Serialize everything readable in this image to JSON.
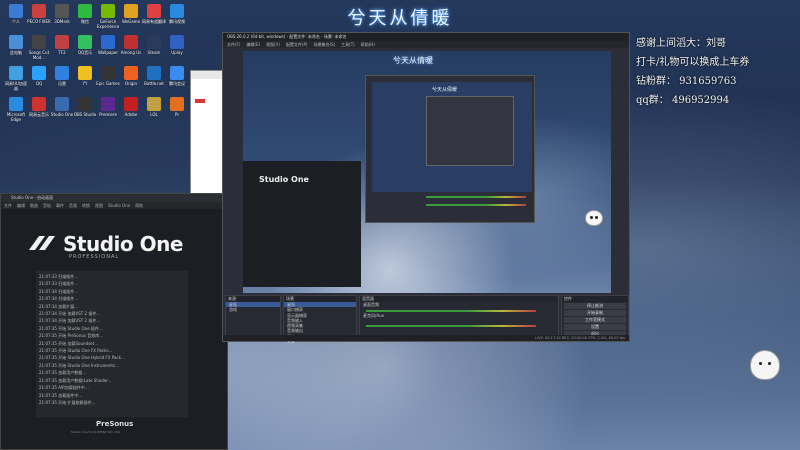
{
  "stream": {
    "title": "兮天从倩暖",
    "thanks": [
      "感谢上间滔大：刘哥",
      "打卡/礼物可以换成上车券",
      "钻粉群： 931659763",
      "qq群： 496952994"
    ]
  },
  "desktop": {
    "icons": [
      {
        "label": "个人",
        "color": "#3a7bd5"
      },
      {
        "label": "PECO FIXER",
        "color": "#c94040"
      },
      {
        "label": "3DMark",
        "color": "#555"
      },
      {
        "label": "微信",
        "color": "#2dbb3f"
      },
      {
        "label": "GeForce Experience",
        "color": "#76b900"
      },
      {
        "label": "WeGame",
        "color": "#e0a020"
      },
      {
        "label": "网易有道翻译",
        "color": "#e04040"
      },
      {
        "label": "腾讯视频",
        "color": "#2a8ae0"
      },
      {
        "label": "此电脑",
        "color": "#4a90d9"
      },
      {
        "label": "Songs Cut Mod...",
        "color": "#444"
      },
      {
        "label": "TF2",
        "color": "#c04040"
      },
      {
        "label": "QQ音乐",
        "color": "#33c060"
      },
      {
        "label": "Wallpaper",
        "color": "#2a6ad0"
      },
      {
        "label": "Among Us",
        "color": "#c03030"
      },
      {
        "label": "Steam",
        "color": "#2a3a5a"
      },
      {
        "label": "Uplay",
        "color": "#3060c0"
      },
      {
        "label": "网易UU加速器",
        "color": "#40a0e0"
      },
      {
        "label": "QQ",
        "color": "#2aa0ff"
      },
      {
        "label": "迅雷",
        "color": "#3080e0"
      },
      {
        "label": "YY",
        "color": "#f0c020"
      },
      {
        "label": "Epic Games",
        "color": "#333"
      },
      {
        "label": "Origin",
        "color": "#f06020"
      },
      {
        "label": "Battle.net",
        "color": "#2070c0"
      },
      {
        "label": "腾讯会议",
        "color": "#3a8af0"
      },
      {
        "label": "Microsoft Edge",
        "color": "#2a8ae0"
      },
      {
        "label": "网易云音乐",
        "color": "#d03030"
      },
      {
        "label": "Studio One",
        "color": "#3a6ab0"
      },
      {
        "label": "OBS Studio",
        "color": "#333"
      },
      {
        "label": "Premiere",
        "color": "#5a2a90"
      },
      {
        "label": "Adobe",
        "color": "#c02020"
      },
      {
        "label": "LOL",
        "color": "#c0a040"
      },
      {
        "label": "Pr",
        "color": "#e07020"
      }
    ]
  },
  "studio_one": {
    "window_title": "Studio One - 启动画面",
    "menu": [
      "文件",
      "编辑",
      "歌曲",
      "音轨",
      "事件",
      "音频",
      "转换",
      "视图",
      "Studio One",
      "帮助"
    ],
    "brand": "Studio One",
    "edition": "PROFESSIONAL",
    "log": [
      "21:07:33  扫描插件...",
      "21:07:33  扫描插件...",
      "21:07:34  扫描插件...",
      "21:07:34  扫描插件...",
      "21:07:34  加载扩展...",
      "21:07:34  开始 加载VST 2 插件...",
      "21:07:34  开始 加载VST 2 插件...",
      "21:07:35  开始 Studio One 插件...",
      "21:07:35  开始 PreSonus 音效库...",
      "21:07:35  开始 加载Soundset...",
      "21:07:35  开始 Studio One FX Packs...",
      "21:07:35  开始 Studio One Hybrid FX Pack...",
      "21:07:35  开始 Studio One Instruments...",
      "21:07:35  加载用户数据...",
      "21:07:35  加载用户数据(Late Shader...",
      "21:07:35  AIR加载插件中...",
      "21:07:35  加载插件中...",
      "21:07:35  开始 扩展依赖插件..."
    ],
    "footer_brand": "PreSonus",
    "version": "Studio One 5.2.0.68562 Win x64"
  },
  "obs": {
    "window_title": "OBS 26.0.2 (64-bit, windows) - 配置文件: 未命名 - 场景: 未命名",
    "menu": [
      "文件(F)",
      "编辑(E)",
      "视图(V)",
      "配置文件(P)",
      "场景集合(S)",
      "工具(T)",
      "帮助(H)"
    ],
    "preview_title": "兮天从倩暖",
    "nested_brand": "Studio One",
    "docks": {
      "scenes_header": "来源",
      "sources_header": "场景",
      "scenes": [
        "桌面",
        "游戏"
      ],
      "sources": [
        "桌面",
        "窗口捕获",
        "显示器捕获",
        "音频输入",
        "视频采集",
        "音频输出",
        "图片",
        "文本"
      ],
      "mixer_header": "混音器",
      "mixer_tracks": [
        "桌面音频",
        "麦克风/Aux"
      ],
      "controls_header": "控件",
      "controls": [
        "停止推流",
        "开始录制",
        "工作室模式",
        "设置",
        "退出"
      ]
    },
    "status": "LIVE: 00:17:34  REC: 00:00:00  CPU: 2.4%, 60.00 fps"
  }
}
